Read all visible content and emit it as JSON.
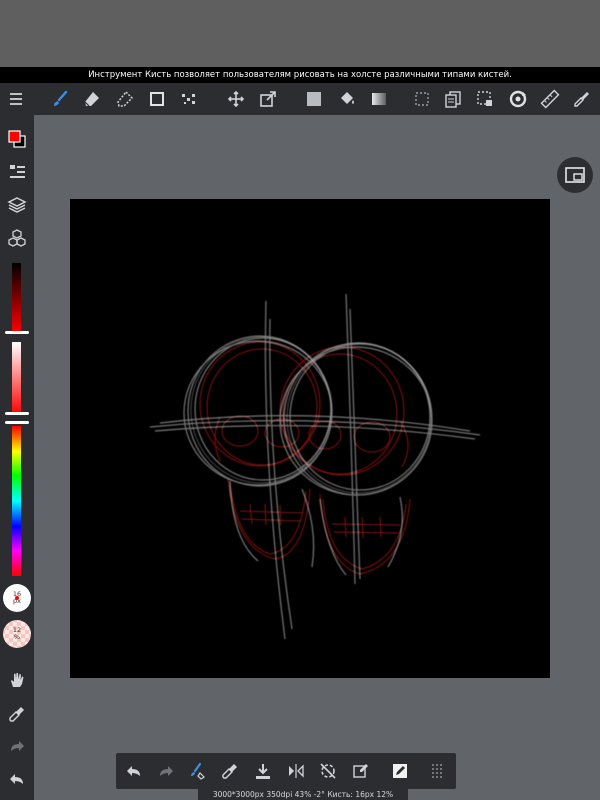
{
  "tooltip": "Инструмент Кисть позволяет пользователям рисовать на холсте различными типами кистей.",
  "toolbar": {
    "items": [
      {
        "name": "menu-icon"
      },
      {
        "name": "brush-icon",
        "active": true
      },
      {
        "name": "eraser-icon"
      },
      {
        "name": "blur-eraser-icon"
      },
      {
        "name": "rectangle-icon"
      },
      {
        "name": "dot-pattern-icon"
      },
      {
        "name": "move-icon"
      },
      {
        "name": "transform-icon"
      },
      {
        "name": "fill-square-icon"
      },
      {
        "name": "bucket-icon"
      },
      {
        "name": "gradient-icon"
      },
      {
        "name": "selection-icon"
      },
      {
        "name": "layers-copy-icon"
      },
      {
        "name": "select-transform-icon"
      },
      {
        "name": "rotate-icon"
      },
      {
        "name": "ruler-icon"
      },
      {
        "name": "eyedropper-icon"
      }
    ]
  },
  "sidebar": {
    "primary_color": "#ff0000",
    "secondary_color": "#000000",
    "brush_size": {
      "value": "16",
      "unit": "px"
    },
    "brush_opacity": {
      "value": "12",
      "unit": "%"
    }
  },
  "status": "3000*3000px 350dpi 43% -2° Кисть: 16px 12%",
  "colors": {
    "accent": "#3b8fe8",
    "panel": "#2b2d31",
    "workspace": "#616468",
    "canvas": "#000000"
  }
}
